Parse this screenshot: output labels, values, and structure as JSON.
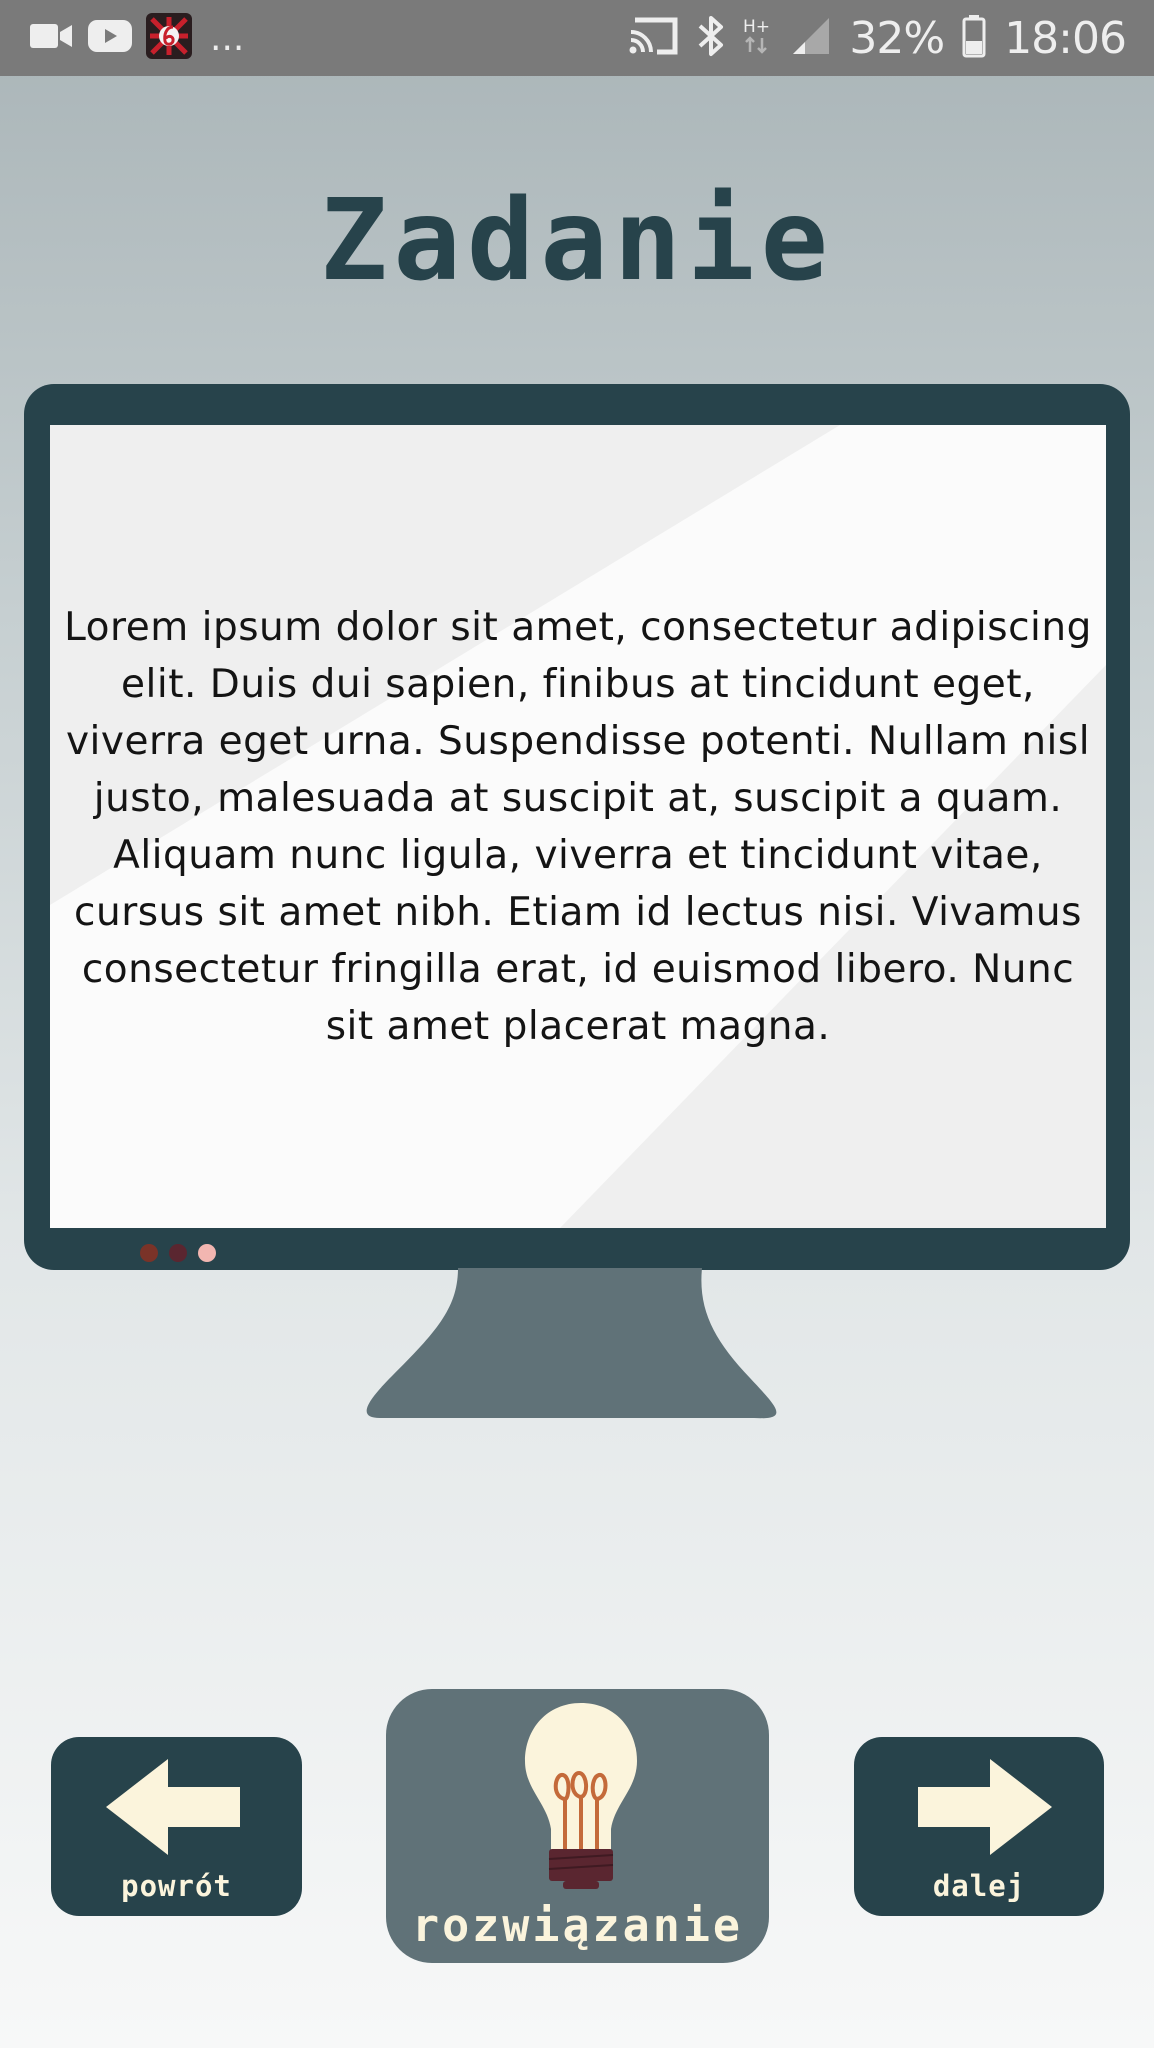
{
  "status_bar": {
    "notification_more": "...",
    "battery_percent": "32%",
    "clock": "18:06",
    "network_label": "H+",
    "icons": [
      "video-icon",
      "youtube-icon",
      "app-icon",
      "cast-icon",
      "bluetooth-icon",
      "signal-icon",
      "battery-icon"
    ]
  },
  "header": {
    "title": "Zadanie"
  },
  "screen": {
    "text": "Lorem ipsum dolor sit amet, consectetur adipiscing elit. Duis dui sapien, finibus at tincidunt eget, viverra eget urna. Suspendisse potenti. Nullam nisl justo, malesuada at suscipit at, suscipit a quam. Aliquam nunc ligula, viverra et tincidunt vitae, cursus sit amet nibh. Etiam id lectus nisi. Vivamus consectetur fringilla erat, id euismod libero. Nunc sit amet placerat magna."
  },
  "buttons": {
    "back": {
      "label": "powrót",
      "icon": "arrow-left-icon"
    },
    "solution": {
      "label": "rozwiązanie",
      "icon": "light-bulb-icon"
    },
    "next": {
      "label": "dalej",
      "icon": "arrow-right-icon"
    }
  },
  "colors": {
    "primary_dark": "#27434b",
    "button_gray": "#607278",
    "label_cream": "#fbf4dc",
    "status_bar": "#7a7a7a",
    "dot_1": "#7a3328",
    "dot_2": "#5a2630",
    "dot_3": "#f2b6b1"
  }
}
